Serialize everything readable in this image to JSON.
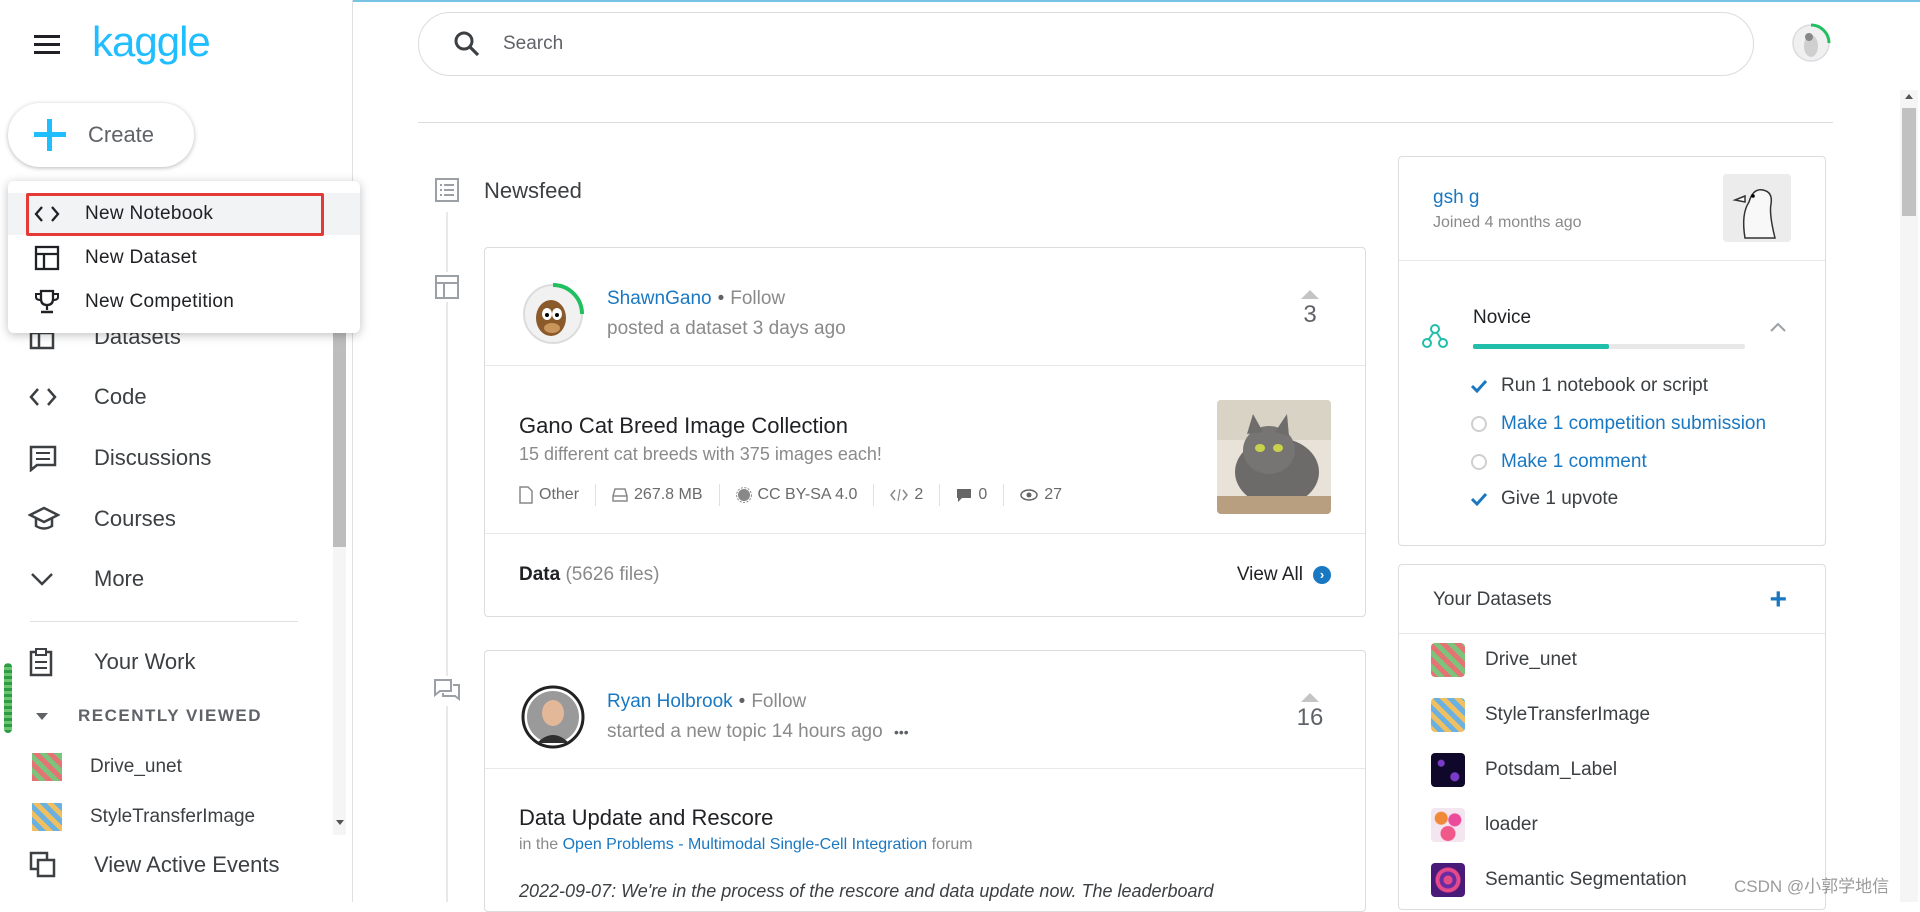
{
  "brand": {
    "logo_text": "kaggle",
    "accent": "#20beff",
    "link": "#1a78c2"
  },
  "create": {
    "label": "Create"
  },
  "create_menu": [
    {
      "label": "New Notebook",
      "icon": "code-brackets-icon"
    },
    {
      "label": "New Dataset",
      "icon": "table-icon"
    },
    {
      "label": "New Competition",
      "icon": "trophy-icon"
    }
  ],
  "nav": [
    {
      "label": "Datasets",
      "icon": "table-icon"
    },
    {
      "label": "Code",
      "icon": "code-brackets-icon"
    },
    {
      "label": "Discussions",
      "icon": "discussion-icon"
    },
    {
      "label": "Courses",
      "icon": "school-icon"
    },
    {
      "label": "More",
      "icon": "chevron-down-icon"
    }
  ],
  "your_work": {
    "label": "Your Work"
  },
  "recently_viewed": {
    "heading": "RECENTLY VIEWED",
    "items": [
      {
        "label": "Drive_unet"
      },
      {
        "label": "StyleTransferImage"
      }
    ]
  },
  "view_active_events": {
    "label": "View Active Events"
  },
  "search": {
    "placeholder": "Search"
  },
  "newsfeed": {
    "title": "Newsfeed"
  },
  "posts": [
    {
      "author": "ShawnGano",
      "follow": "Follow",
      "action": "posted a dataset 3 days ago",
      "votes": "3",
      "title": "Gano Cat Breed Image Collection",
      "subtitle": "15 different cat breeds with 375 images each!",
      "meta": {
        "type": "Other",
        "size": "267.8 MB",
        "license": "CC BY-SA 4.0",
        "code": "2",
        "comments": "0",
        "views": "27"
      },
      "data_label": "Data",
      "data_count": "(5626 files)",
      "view_all": "View All"
    },
    {
      "author": "Ryan Holbrook",
      "follow": "Follow",
      "action": "started a new topic 14 hours ago",
      "more": "•••",
      "votes": "16",
      "title": "Data Update and Rescore",
      "in_the": "in the",
      "forum_link": "Open Problems - Multimodal Single-Cell Integration",
      "forum": "forum",
      "body": "2022-09-07: We're in the process of the rescore and data update now. The leaderboard"
    }
  ],
  "profile": {
    "name": "gsh g",
    "joined": "Joined 4 months ago"
  },
  "progress": {
    "tier": "Novice",
    "fraction": 0.5,
    "tasks": [
      {
        "label": "Run 1 notebook or script",
        "done": true
      },
      {
        "label": "Make 1 competition submission",
        "done": false
      },
      {
        "label": "Make 1 comment",
        "done": false
      },
      {
        "label": "Give 1 upvote",
        "done": true
      }
    ]
  },
  "your_datasets": {
    "heading": "Your Datasets",
    "add": "+",
    "items": [
      {
        "label": "Drive_unet"
      },
      {
        "label": "StyleTransferImage"
      },
      {
        "label": "Potsdam_Label"
      },
      {
        "label": "loader"
      },
      {
        "label": "Semantic Segmentation"
      }
    ]
  },
  "watermark": "CSDN @小郭学地信"
}
